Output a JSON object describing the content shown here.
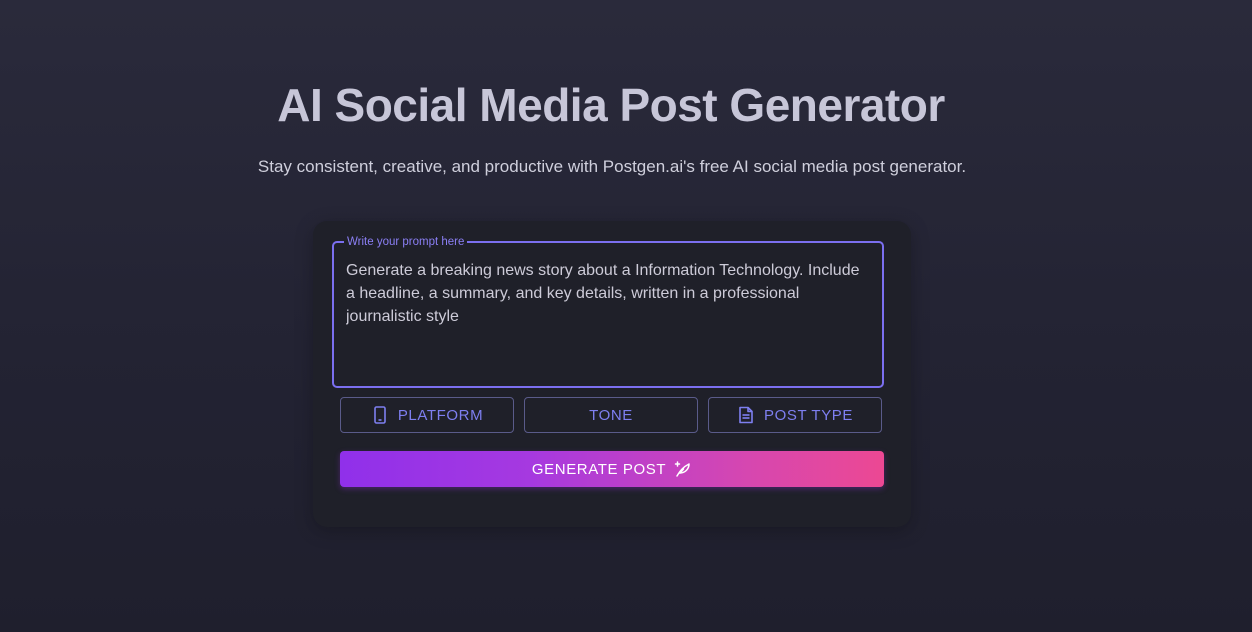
{
  "hero": {
    "title": "AI Social Media Post Generator",
    "subtitle": "Stay consistent, creative, and productive with Postgen.ai's free AI social media post generator."
  },
  "prompt": {
    "label": "Write your prompt here",
    "value": "Generate a breaking news story about a Information Technology. Include a headline, a summary, and key details, written in a professional journalistic style"
  },
  "options": {
    "platform_label": "PLATFORM",
    "platform_icon": "smartphone-icon",
    "tone_label": "TONE",
    "post_type_label": "POST TYPE",
    "post_type_icon": "document-icon"
  },
  "generate": {
    "label": "GENERATE POST",
    "icon": "quill-sparkle-icon"
  },
  "colors": {
    "background": "#25253a",
    "card": "#1f2029",
    "accent": "#7b6ff0",
    "gradient_start": "#9030ea",
    "gradient_end": "#ec4893"
  }
}
